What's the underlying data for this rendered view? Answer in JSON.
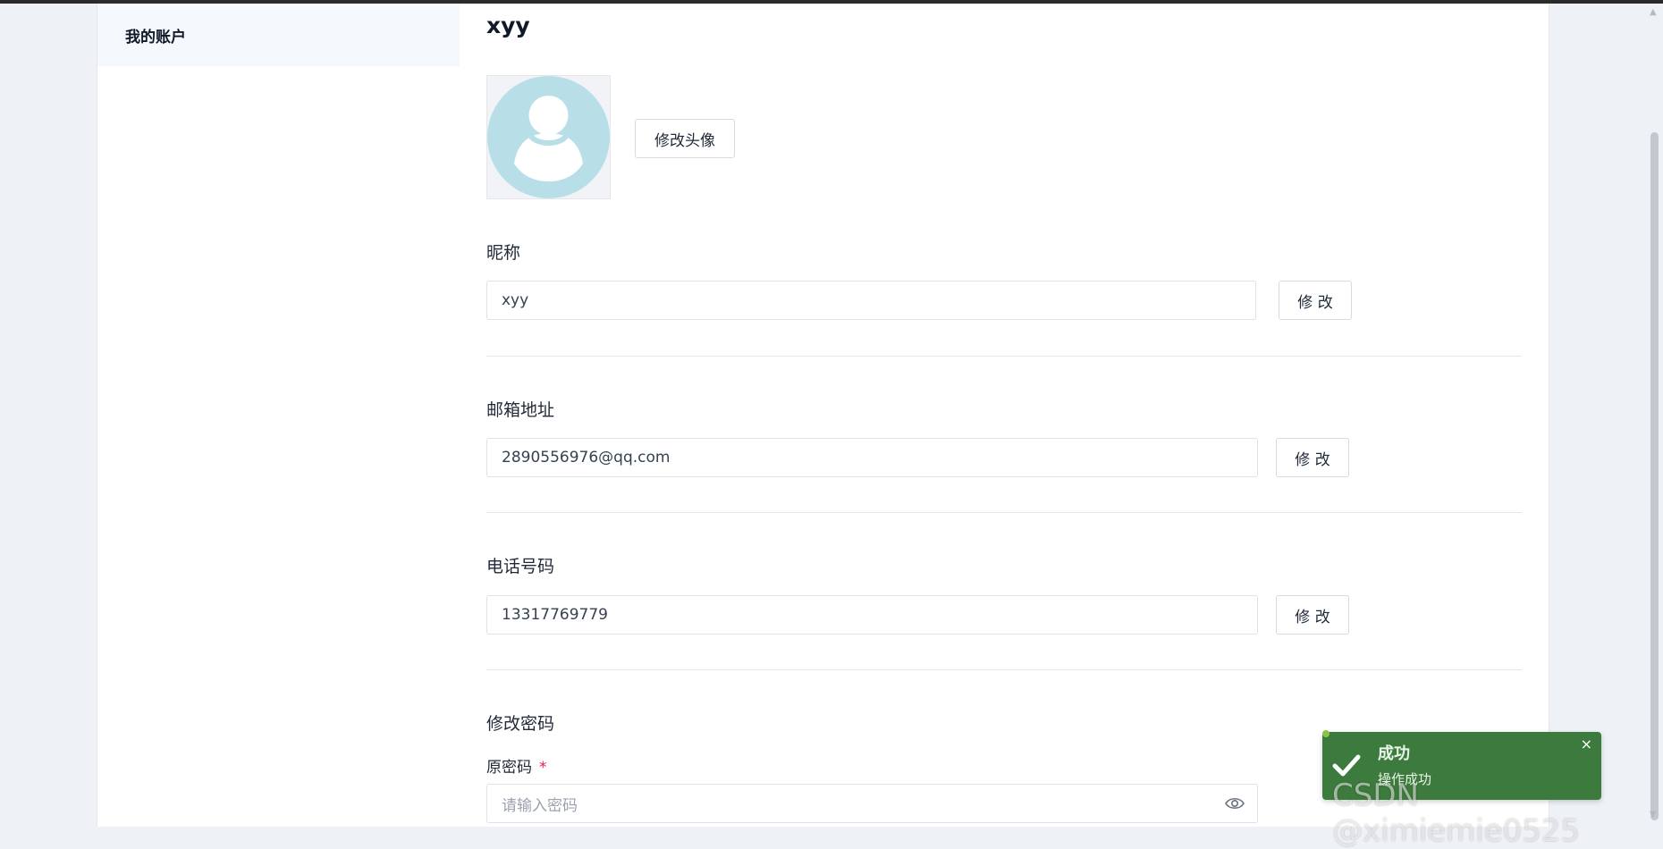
{
  "sidebar": {
    "items": [
      {
        "label": "我的账户"
      }
    ]
  },
  "profile": {
    "username": "xyy",
    "change_avatar_label": "修改头像",
    "nickname": {
      "label": "昵称",
      "value": "xyy",
      "button": "修 改"
    },
    "email": {
      "label": "邮箱地址",
      "value": "2890556976@qq.com",
      "button": "修 改"
    },
    "phone": {
      "label": "电话号码",
      "value": "13317769779",
      "button": "修 改"
    },
    "password": {
      "section_label": "修改密码",
      "old_password_label": "原密码",
      "required_mark": "*",
      "old_password_placeholder": "请输入密码"
    }
  },
  "toast": {
    "title": "成功",
    "message": "操作成功",
    "close": "×"
  },
  "watermark": "CSDN @ximiemie0525",
  "icons": [
    "user-avatar-icon",
    "eye-icon",
    "check-icon",
    "close-icon"
  ],
  "colors": {
    "toast_bg": "#3d7a3d",
    "avatar": "#b8dfe8",
    "required": "#e11d48"
  }
}
